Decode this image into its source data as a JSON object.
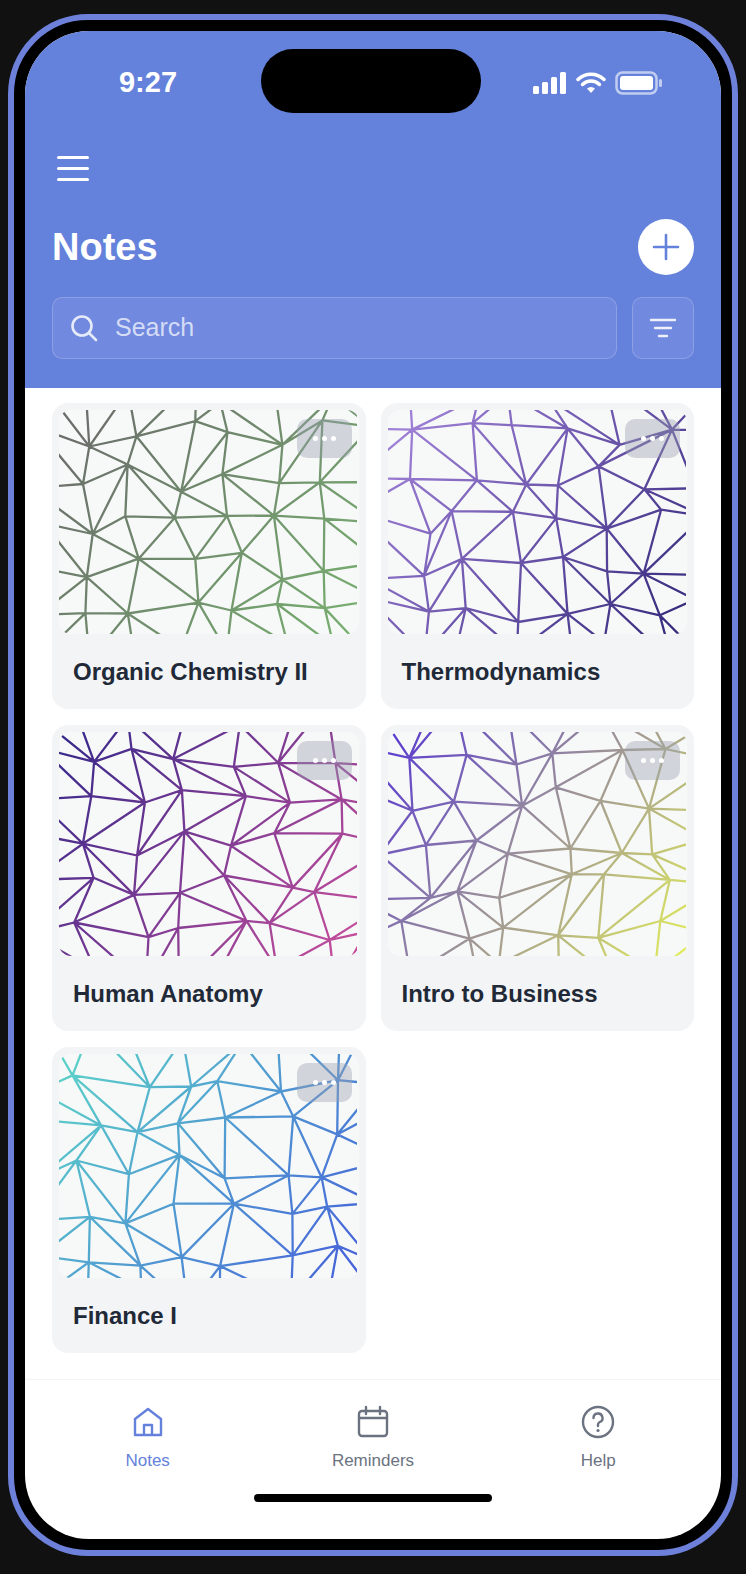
{
  "status_bar": {
    "time": "9:27"
  },
  "header": {
    "title": "Notes"
  },
  "search": {
    "placeholder": "Search"
  },
  "notes": [
    {
      "title": "Organic Chemistry II",
      "colors": [
        "#6a6a6a",
        "#78b070"
      ]
    },
    {
      "title": "Thermodynamics",
      "colors": [
        "#a585dc",
        "#33277a"
      ]
    },
    {
      "title": "Human Anatomy",
      "colors": [
        "#35288a",
        "#c84f9c"
      ]
    },
    {
      "title": "Intro to Business",
      "colors": [
        "#5838d2",
        "#e2ee5c"
      ]
    },
    {
      "title": "Finance I",
      "colors": [
        "#5cd4c8",
        "#4660da"
      ]
    }
  ],
  "nav": [
    {
      "label": "Notes",
      "selected": true
    },
    {
      "label": "Reminders",
      "selected": false
    },
    {
      "label": "Help",
      "selected": false
    }
  ]
}
